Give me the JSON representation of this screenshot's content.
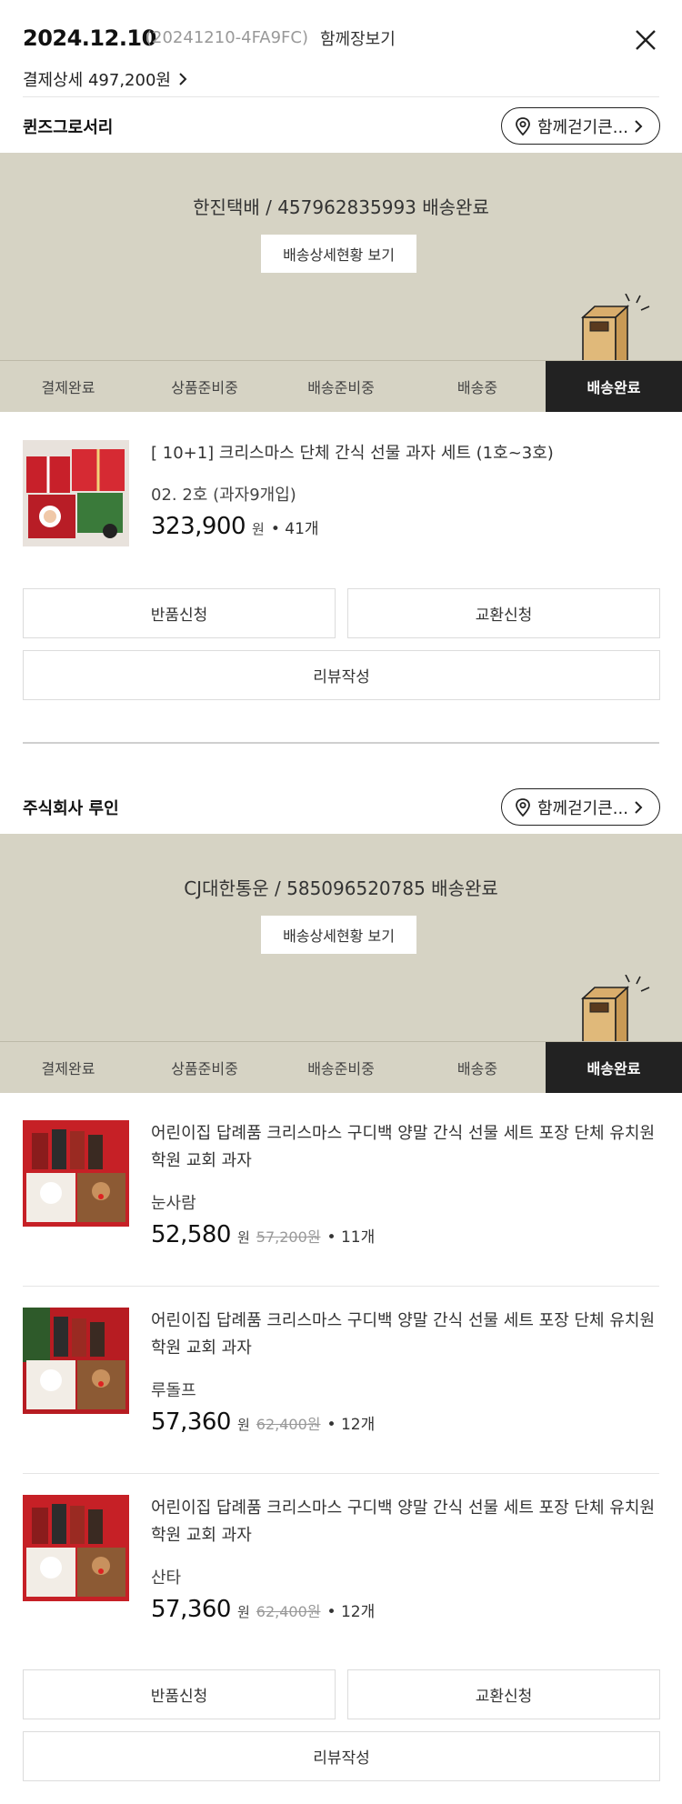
{
  "header": {
    "date": "2024.12.10",
    "order_no": "(20241210-4FA9FC)",
    "cart_link": "함께장보기",
    "payment_detail": "결제상세 497,200원"
  },
  "sellers": [
    {
      "name": "퀸즈그로서리",
      "walk_label": "함께걷기큰...",
      "tracking_text": "한진택배 / 457962835993 배송완료",
      "tracking_button": "배송상세현황 보기",
      "steps": [
        "결제완료",
        "상품준비중",
        "배송준비중",
        "배송중",
        "배송완료"
      ],
      "items": [
        {
          "name": "[ 10+1] 크리스마스 단체 간식 선물 과자 세트 (1호~3호)",
          "option": "02. 2호 (과자9개입)",
          "price": "323,900",
          "won": "원",
          "orig": "",
          "qty": "• 41개"
        }
      ],
      "actions": {
        "return": "반품신청",
        "exchange": "교환신청",
        "review": "리뷰작성"
      }
    },
    {
      "name": "주식회사 루인",
      "walk_label": "함께걷기큰...",
      "tracking_text": "CJ대한통운 / 585096520785 배송완료",
      "tracking_button": "배송상세현황 보기",
      "steps": [
        "결제완료",
        "상품준비중",
        "배송준비중",
        "배송중",
        "배송완료"
      ],
      "items": [
        {
          "name": "어린이집 답례품 크리스마스 구디백 양말 간식 선물 세트 포장 단체 유치원 학원 교회 과자",
          "option": "눈사람",
          "price": "52,580",
          "won": "원",
          "orig": "57,200원",
          "qty": "• 11개"
        },
        {
          "name": "어린이집 답례품 크리스마스 구디백 양말 간식 선물 세트 포장 단체 유치원 학원 교회 과자",
          "option": "루돌프",
          "price": "57,360",
          "won": "원",
          "orig": "62,400원",
          "qty": "• 12개"
        },
        {
          "name": "어린이집 답례품 크리스마스 구디백 양말 간식 선물 세트 포장 단체 유치원 학원 교회 과자",
          "option": "산타",
          "price": "57,360",
          "won": "원",
          "orig": "62,400원",
          "qty": "• 12개"
        }
      ],
      "actions": {
        "return": "반품신청",
        "exchange": "교환신청",
        "review": "리뷰작성"
      }
    }
  ],
  "active_step_index": 4,
  "colors": {
    "tracking_bg": "#d6d3c4",
    "active_step_bg": "#222222",
    "box": "#e0b97a"
  },
  "icons": [
    "close-icon",
    "chevron-right-icon",
    "location-pin-icon",
    "package-box-icon"
  ]
}
